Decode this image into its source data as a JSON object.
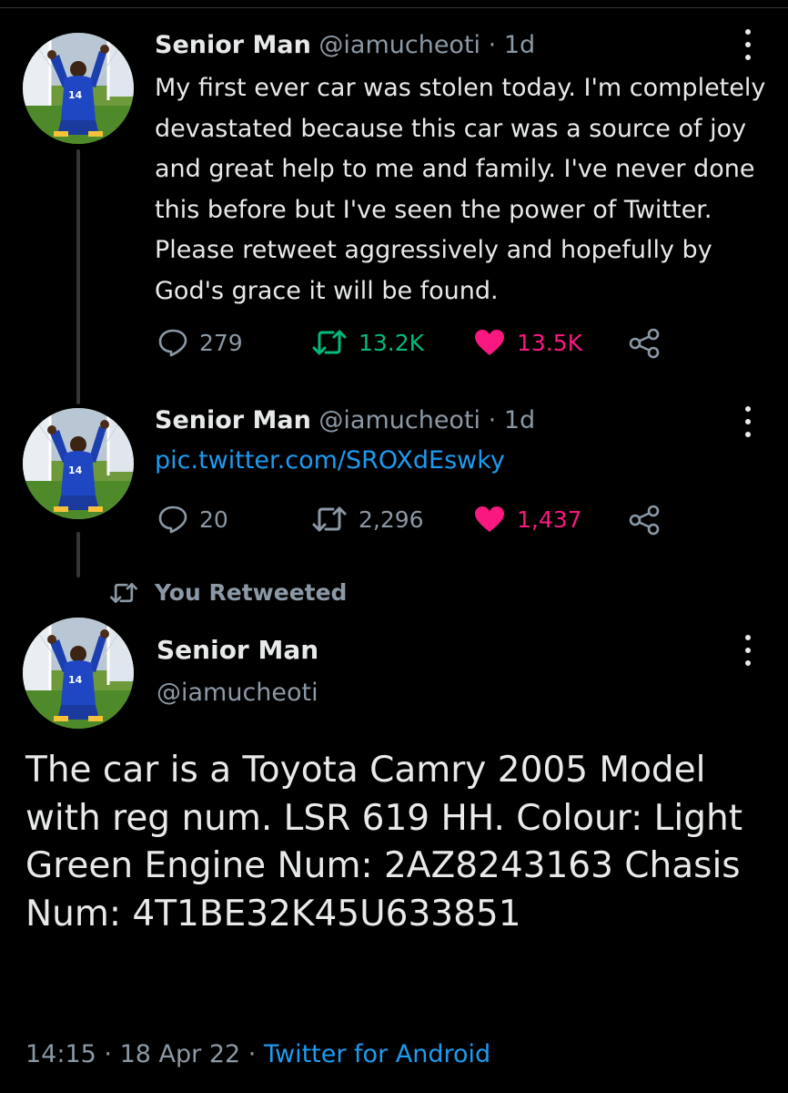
{
  "tweets": [
    {
      "name": "Senior Man",
      "handle": "@iamucheoti",
      "separator": "·",
      "time": "1d",
      "text": "My first ever car was stolen today. I'm completely devastated because this car was a source of joy and great help to me and family. I've never done this before but I've seen the power of Twitter. Please retweet aggressively and hopefully by God's grace it will be found.",
      "replies": "279",
      "retweets": "13.2K",
      "likes": "13.5K",
      "retweeted_by_me": true,
      "liked_by_me": true
    },
    {
      "name": "Senior Man",
      "handle": "@iamucheoti",
      "separator": "·",
      "time": "1d",
      "link": "pic.twitter.com/SROXdEswky",
      "replies": "20",
      "retweets": "2,296",
      "likes": "1,437",
      "retweeted_by_me": false,
      "liked_by_me": true
    }
  ],
  "retweet_banner": "You Retweeted",
  "main_tweet": {
    "name": "Senior Man",
    "handle": "@iamucheoti",
    "text": "The car is a Toyota Camry 2005 Model with reg num. LSR 619 HH. Colour: Light Green Engine Num: 2AZ8243163 Chasis Num: 4T1BE32K45U633851",
    "timestamp": "14:15",
    "separator": "·",
    "date": "18 Apr 22",
    "source": "Twitter for Android"
  },
  "icons": {
    "reply": "reply-icon",
    "retweet": "retweet-icon",
    "like": "heart-icon",
    "share": "share-icon",
    "more": "more-options-icon"
  },
  "colors": {
    "background": "#000000",
    "text": "#e7e9ea",
    "muted": "#8b98a5",
    "link": "#1d9bf0",
    "retweet_active": "#00ba7c",
    "like_active": "#f91880",
    "thread_line": "#333639"
  }
}
